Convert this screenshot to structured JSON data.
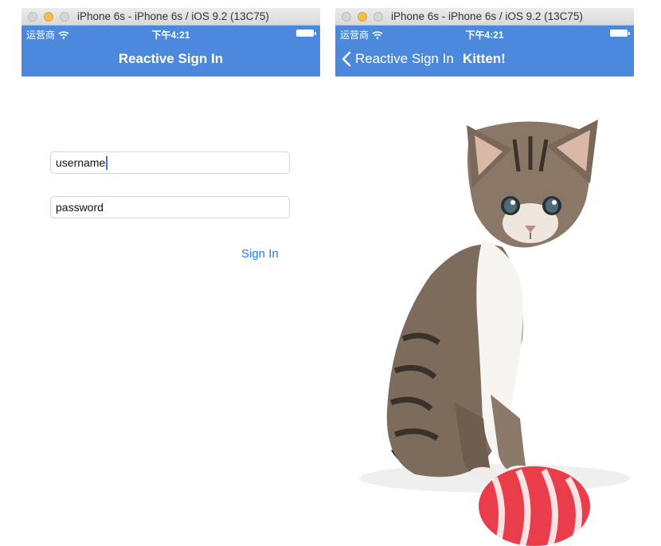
{
  "windows": [
    {
      "title": "iPhone 6s - iPhone 6s / iOS 9.2 (13C75)",
      "status": {
        "carrier": "运营商",
        "time": "下午4:21"
      },
      "nav": {
        "title": "Reactive Sign In"
      },
      "form": {
        "username_value": "username",
        "password_value": "password",
        "signin_label": "Sign In"
      }
    },
    {
      "title": "iPhone 6s - iPhone 6s / iOS 9.2 (13C75)",
      "status": {
        "carrier": "运营商",
        "time": "下午4:21"
      },
      "nav": {
        "back_label": "Reactive Sign In",
        "title": "Kitten!"
      },
      "image": {
        "icon": "kitten-photo"
      }
    }
  ],
  "colors": {
    "nav_bar": "#4a89dc",
    "link": "#1a7cf5",
    "window_minimize": "#f6be4f"
  }
}
